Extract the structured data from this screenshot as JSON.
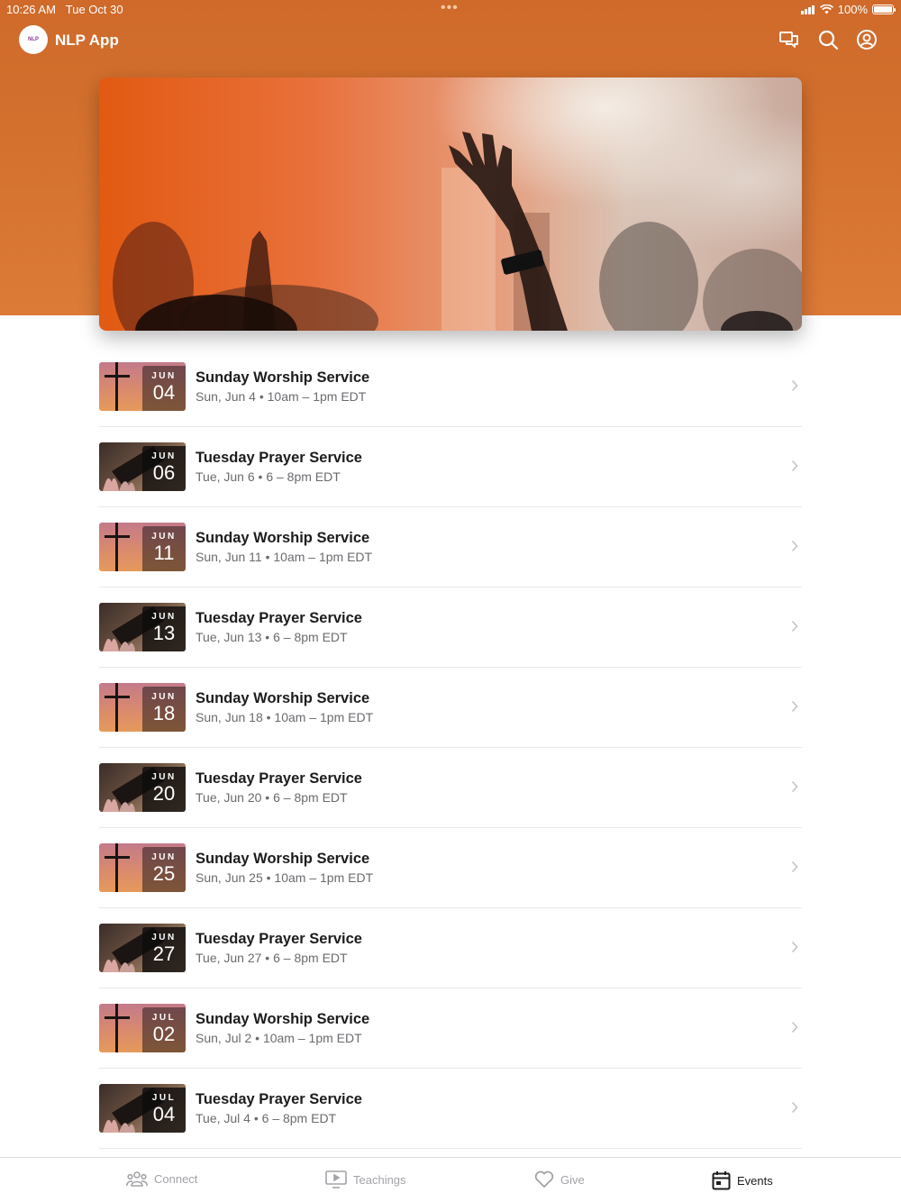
{
  "status_bar": {
    "time": "10:26 AM",
    "date": "Tue Oct 30",
    "multitask_dots": "•••",
    "battery": "100%"
  },
  "header": {
    "app_title": "NLP App",
    "logo_text": "NLP",
    "icons": [
      "chat-icon",
      "search-icon",
      "account-icon"
    ],
    "accent_color": "#d4712f"
  },
  "events": [
    {
      "title": "Sunday Worship Service",
      "meta": "Sun, Jun 4 • 10am – 1pm EDT",
      "month": "JUN",
      "day": "04",
      "thumb": "cross"
    },
    {
      "title": "Tuesday Prayer Service",
      "meta": "Tue, Jun 6 • 6 – 8pm EDT",
      "month": "JUN",
      "day": "06",
      "thumb": "bible"
    },
    {
      "title": "Sunday Worship Service",
      "meta": "Sun, Jun 11 • 10am – 1pm EDT",
      "month": "JUN",
      "day": "11",
      "thumb": "cross"
    },
    {
      "title": "Tuesday Prayer Service",
      "meta": "Tue, Jun 13 • 6 – 8pm EDT",
      "month": "JUN",
      "day": "13",
      "thumb": "bible"
    },
    {
      "title": "Sunday Worship Service",
      "meta": "Sun, Jun 18 • 10am – 1pm EDT",
      "month": "JUN",
      "day": "18",
      "thumb": "cross"
    },
    {
      "title": "Tuesday Prayer Service",
      "meta": "Tue, Jun 20 • 6 – 8pm EDT",
      "month": "JUN",
      "day": "20",
      "thumb": "bible"
    },
    {
      "title": "Sunday Worship Service",
      "meta": "Sun, Jun 25 • 10am – 1pm EDT",
      "month": "JUN",
      "day": "25",
      "thumb": "cross"
    },
    {
      "title": "Tuesday Prayer Service",
      "meta": "Tue, Jun 27 • 6 – 8pm EDT",
      "month": "JUN",
      "day": "27",
      "thumb": "bible"
    },
    {
      "title": "Sunday Worship Service",
      "meta": "Sun, Jul 2 • 10am – 1pm EDT",
      "month": "JUL",
      "day": "02",
      "thumb": "cross"
    },
    {
      "title": "Tuesday Prayer Service",
      "meta": "Tue, Jul 4 • 6 – 8pm EDT",
      "month": "JUL",
      "day": "04",
      "thumb": "bible"
    }
  ],
  "tabbar": {
    "tabs": [
      {
        "label": "Connect",
        "icon": "people-icon",
        "active": false
      },
      {
        "label": "Teachings",
        "icon": "play-screen-icon",
        "active": false
      },
      {
        "label": "Give",
        "icon": "heart-icon",
        "active": false
      },
      {
        "label": "Events",
        "icon": "calendar-icon",
        "active": true
      }
    ]
  }
}
